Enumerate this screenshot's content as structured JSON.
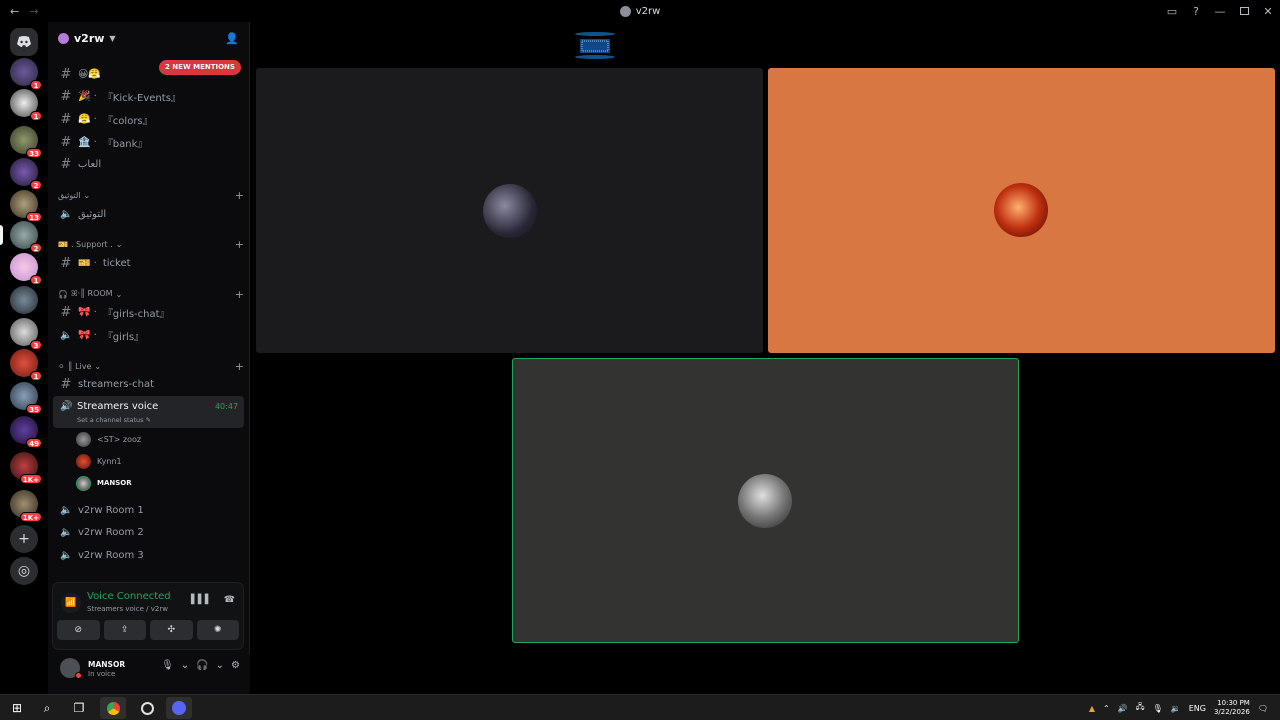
{
  "window": {
    "title": "v2rw",
    "back_icon": "←",
    "forward_icon": "→",
    "right_icons": [
      "inbox-icon",
      "help-icon",
      "minimize-icon",
      "maximize-icon",
      "close-icon"
    ],
    "help_glyph": "?",
    "minimize_glyph": "—",
    "close_glyph": "✕"
  },
  "guilds": {
    "badges": [
      "1",
      "1",
      "33",
      "2",
      "13",
      "2",
      "1",
      "3",
      "1",
      "35",
      "49",
      "1K+",
      "1K+"
    ]
  },
  "server": {
    "name": "v2rw",
    "mentions_label": "2 NEW MENTIONS",
    "channels": {
      "kick_events": "『Kick-Events』",
      "colors": "『colors』",
      "bank": "『bank』",
      "arabic_text": "العاب",
      "ticket": "ticket",
      "girls_chat": "『girls-chat』",
      "girls": "『girls』",
      "streamers_chat": "streamers-chat",
      "room1": "v2rw Room 1",
      "room2": "v2rw Room 2",
      "room3": "v2rw Room 3",
      "arabic_voice": "التوثيق"
    },
    "categories": {
      "arabic_cat": "التوثيق",
      "support": ". Support .",
      "room": "ꕤ·║ ROOM",
      "live": "║ Live"
    },
    "active_voice": {
      "name": "Streamers voice",
      "status": "Set a channel status ✎",
      "time": "40:47"
    },
    "members": [
      "<ST> zooz",
      "Kynn1",
      "MANSOR"
    ]
  },
  "voice_panel": {
    "title": "Voice Connected",
    "subtitle": "Streamers voice / v2rw"
  },
  "user": {
    "name": "MANSOR",
    "status": "In voice"
  },
  "colors": {
    "accent_green": "#23a55a",
    "tile_orange": "#d97742",
    "tile_dark": "#1b1a1c",
    "tile_grey": "#333432"
  },
  "taskbar": {
    "lang": "ENG",
    "time": "10:30 PM",
    "date": "3/22/2026"
  }
}
